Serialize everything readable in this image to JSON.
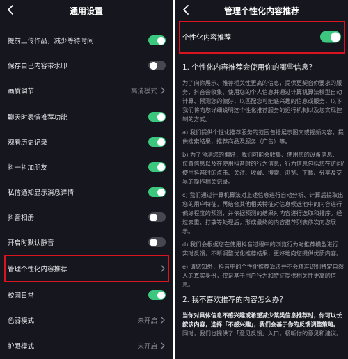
{
  "left": {
    "title": "通用设置",
    "items": [
      {
        "label": "提前上传作品，减少等待时间",
        "toggle": "on"
      },
      {
        "label": "保存自己内容带水印",
        "toggle": "off"
      },
      {
        "label": "画质调节",
        "value": "高清模式"
      },
      {
        "label": "聊天时表情推荐功能",
        "toggle": "on"
      },
      {
        "label": "观看历史记录",
        "toggle": "on"
      },
      {
        "label": "抖一抖加朋友",
        "toggle": "on"
      },
      {
        "label": "私信通知显示消息详情",
        "toggle": "on"
      },
      {
        "label": "抖音相册",
        "toggle": "off"
      },
      {
        "label": "开启时默认静音",
        "toggle": "off"
      },
      {
        "label": "管理个性化内容推荐"
      },
      {
        "label": "校园日常",
        "toggle": "on"
      },
      {
        "label": "色弱模式",
        "value": "未开启"
      },
      {
        "label": "护眼模式",
        "value": "未开启"
      }
    ]
  },
  "right": {
    "title": "管理个性化内容推荐",
    "toggle_label": "个性化内容推荐",
    "toggle_state": "on",
    "section1_title": "1. 个性化内容推荐会使用你的哪些信息？",
    "paragraphs": [
      "为了向你展示、推荐相关性更高的信息，提供更契合你要求的服务，抖音会收集、使用您的个人信息并通过计算机算法模型自动计算、预测您的偏好，以匹配您可能感兴趣的信息或服务，以下我们将向您详细说明这个性化推荐服务的运行机制以及您实现控制的方式。",
      "a) 我们提供个性化推荐服务的范围包括展示图文或视频内容，提供搜索结果，推荐商品及服务（广告）等。",
      "b) 为了预测您的偏好，我们可能会收集、使用您的设备信息、位置信息以及在使用抖音时的行为信息，行为信息包括您在访问/使用抖音时的点击、关注、收藏、搜索、浏览、下载、分享及交易的操作相关记录。",
      "c) 我们通过计算机算法对上述信息进行自动分析、计算后提取出您的用户特征，再结合其他相关特征对信息候选池中的内容进行偏好程度的预测，并依据预测的结果对内容进行选取和排序。经过去重、打散等处理后，形成最终的内容推荐列表依次向您展示。",
      "d) 我们会根据您在使用抖音过程中的浏览行为对推荐模型进行实时反馈，不断调整优化推荐结果，更好地向您提供优质内容。",
      "e) 请您知悉，抖音中的个性化推荐算法并不会精准识别特定自然人的真实身份，仅是基于用户行为和特征提供相关性更高的信息。"
    ],
    "section2_title": "2. 我不喜欢推荐的内容怎么办？",
    "section2_bold": "当你对具体信息不感兴趣或希望减少某类信息推荐时，你可以长按该内容，选择「不感兴趣」，我们会基于你的反馈调整策略。",
    "section2_rest": "同时，我们也提供了「意见反馈」入口，畅听你的意见和建议。"
  }
}
